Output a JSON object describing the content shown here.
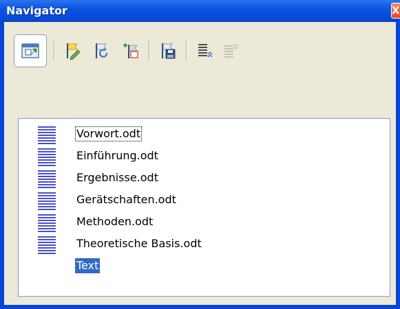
{
  "window": {
    "title": "Navigator",
    "close_glyph": "X"
  },
  "toolbar": {
    "buttons": [
      {
        "name": "toggle-icon",
        "active": true
      },
      {
        "name": "edit-icon"
      },
      {
        "name": "update-icon"
      },
      {
        "name": "insert-icon"
      },
      {
        "name": "save-as-icon"
      },
      {
        "name": "move-up-icon"
      },
      {
        "name": "move-down-icon"
      }
    ]
  },
  "list": {
    "items": [
      {
        "label": "Vorwort.odt"
      },
      {
        "label": "Einführung.odt"
      },
      {
        "label": "Ergebnisse.odt"
      },
      {
        "label": "Gerätschaften.odt"
      },
      {
        "label": "Methoden.odt"
      },
      {
        "label": "Theoretische Basis.odt"
      },
      {
        "label": "Text"
      }
    ]
  }
}
